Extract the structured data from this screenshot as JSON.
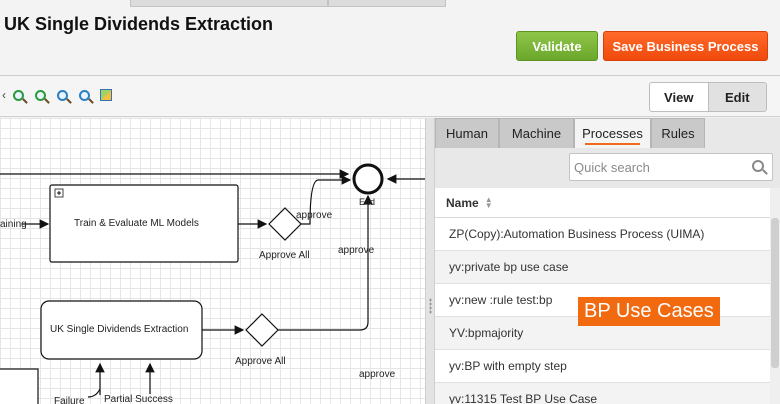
{
  "header": {
    "title": "UK Single Dividends Extraction",
    "validate_label": "Validate",
    "save_label": "Save Business Process"
  },
  "toolbar": {
    "icons": [
      "zoom-in-icon",
      "zoom-out-icon",
      "zoom-fit-icon",
      "zoom-actual-icon",
      "overview-icon"
    ],
    "view_label": "View",
    "edit_label": "Edit"
  },
  "diagram": {
    "end_label": "End",
    "node_train": "Train & Evaluate ML Models",
    "node_uk": "UK Single Dividends Extraction",
    "gateway1_label": "Approve All",
    "gateway2_label": "Approve All",
    "edge_approve_1": "approve",
    "edge_approve_2": "approve",
    "edge_approve_3": "approve",
    "edge_training": "aining",
    "edge_failure": "Failure",
    "edge_partial": "Partial Success",
    "expand_marker": "+"
  },
  "panel": {
    "tabs": [
      {
        "label": "Human"
      },
      {
        "label": "Machine"
      },
      {
        "label": "Processes"
      },
      {
        "label": "Rules"
      }
    ],
    "active_tab": "Processes",
    "search_placeholder": "Quick search",
    "column_name": "Name",
    "rows": [
      "ZP(Copy):Automation Business Process (UIMA)",
      "yv:private bp use case",
      "yv:new :rule test:bp",
      "YV:bpmajority",
      "yv:BP with empty step",
      "yv:11315 Test BP Use Case"
    ]
  },
  "overlay_label": "BP Use Cases",
  "colors": {
    "validate": "#7ab536",
    "save": "#f2581a",
    "tab_underline": "#ef6a1a",
    "overlay": "#f26a10"
  }
}
